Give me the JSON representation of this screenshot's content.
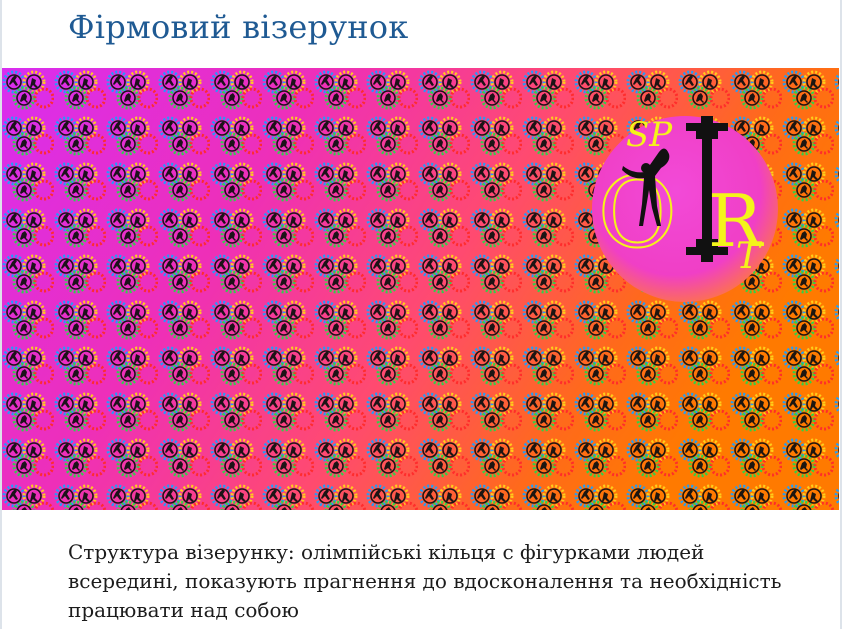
{
  "page": {
    "title": "Фірмовий візерунок"
  },
  "banner": {
    "pattern_icon": "olympic-rings-figure-icon",
    "gradient_colors": [
      "#d82ef0",
      "#f0289a",
      "#ff6a1a",
      "#ff7a00"
    ],
    "logo": {
      "letters_top": "SP",
      "letter_o": "O",
      "letter_r": "R",
      "letter_t": "T",
      "circle_color": "#f03fd0",
      "letter_color": "#f4f41a",
      "barbell_color": "#111111",
      "icon": "gymnast-silhouette-icon"
    }
  },
  "caption": {
    "text": "Структура візерунку: олімпійські кільця с фігурками людей всередині, показують прагнення до вдосконалення та необхідність працювати над собою"
  }
}
